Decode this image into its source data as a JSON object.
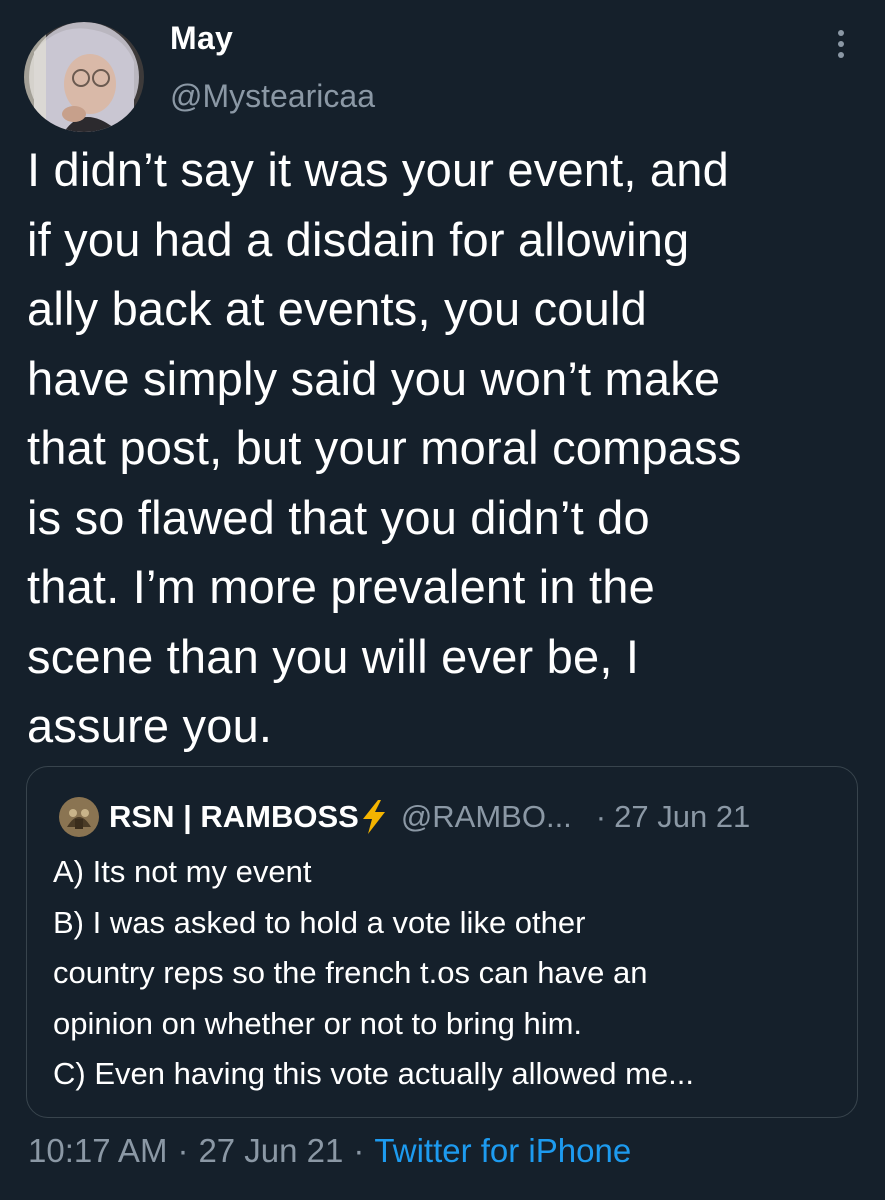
{
  "author": {
    "display_name": "May",
    "handle": "@Mystearicaa"
  },
  "tweet": {
    "text_lines": [
      "I didn’t say it was your event, and",
      "if you had a disdain for allowing",
      "ally back at events, you could",
      "have simply said you won’t make",
      "that post, but your moral compass",
      "is so flawed that you didn’t do",
      "that. I’m more prevalent in the",
      "scene than you will ever be, I",
      "assure you."
    ]
  },
  "quoted_tweet": {
    "display_name": "RSN | RAMBOSS",
    "name_emoji_icon": "lightning-bolt-icon",
    "handle": "@RAMBO...",
    "separator": "·",
    "date": "27 Jun 21",
    "text_lines": [
      "A) Its not my event",
      "B) I was asked to hold a vote like other",
      "country reps so the french t.os can have an",
      "opinion on whether or not to bring him.",
      "C) Even having this vote actually allowed me..."
    ]
  },
  "meta": {
    "time": "10:17 AM",
    "separator": "·",
    "date": "27 Jun 21",
    "source": "Twitter for iPhone"
  },
  "icons": {
    "more": "more-vertical-icon",
    "avatar": "avatar",
    "quote_avatar": "avatar"
  },
  "colors": {
    "background": "#15202b",
    "text_primary": "#ffffff",
    "text_secondary": "#8b98a5",
    "link": "#1d9bf0",
    "border": "#38444d",
    "bolt": "#f4b400"
  }
}
